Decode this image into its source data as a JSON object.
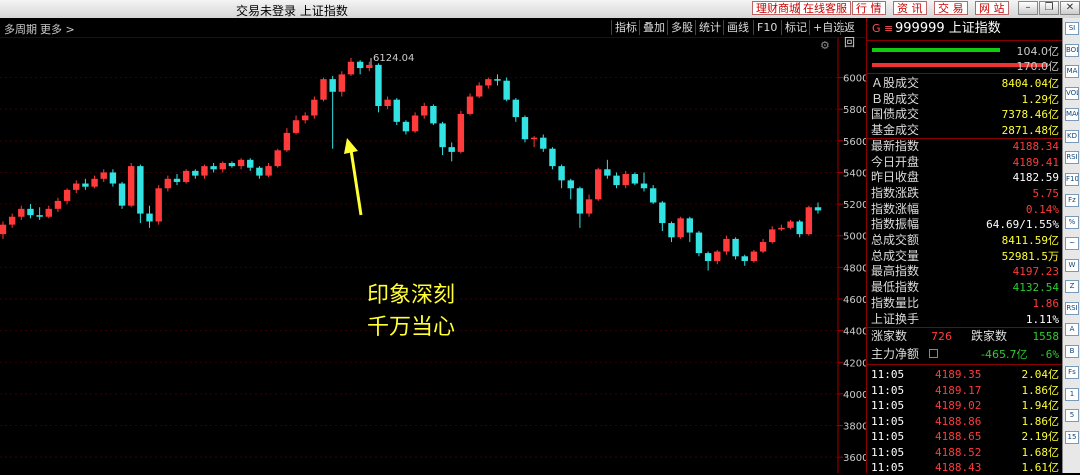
{
  "window": {
    "title": "交易未登录 上证指数",
    "top_buttons": [
      "理财商城",
      "在线客服",
      "行 情",
      "资 讯",
      "交 易",
      "网 站"
    ]
  },
  "toolbar": {
    "left_items": [
      "多周期",
      "更多 >"
    ],
    "right_items": [
      "指标",
      "叠加",
      "多股",
      "统计",
      "画线",
      "F10",
      "标记",
      "+自选",
      "返回"
    ]
  },
  "chart": {
    "y_ticks": [
      "6000",
      "5800",
      "5600",
      "5400",
      "5200",
      "5000",
      "4800",
      "4600",
      "4400",
      "4200",
      "4000",
      "3800",
      "3600"
    ],
    "peak_label": "6124.04",
    "annotation": [
      "印象深刻",
      "千万当心"
    ],
    "colors": {
      "up": "#ff3b3b",
      "down": "#33e3e3",
      "arrow": "#ffff33",
      "axis": "#aa0000"
    }
  },
  "chart_data": {
    "type": "candlestick",
    "ylim": [
      3500,
      6250
    ],
    "candles": [
      [
        5010,
        5070,
        4980,
        5090
      ],
      [
        5070,
        5120,
        5050,
        5140
      ],
      [
        5120,
        5170,
        5100,
        5190
      ],
      [
        5170,
        5130,
        5110,
        5200
      ],
      [
        5130,
        5120,
        5100,
        5180
      ],
      [
        5120,
        5170,
        5110,
        5190
      ],
      [
        5170,
        5220,
        5150,
        5240
      ],
      [
        5220,
        5290,
        5200,
        5300
      ],
      [
        5290,
        5330,
        5270,
        5350
      ],
      [
        5330,
        5310,
        5290,
        5360
      ],
      [
        5310,
        5360,
        5300,
        5380
      ],
      [
        5360,
        5400,
        5340,
        5420
      ],
      [
        5400,
        5330,
        5310,
        5420
      ],
      [
        5330,
        5190,
        5170,
        5340
      ],
      [
        5190,
        5440,
        5180,
        5460
      ],
      [
        5440,
        5140,
        5080,
        5450
      ],
      [
        5140,
        5090,
        5050,
        5190
      ],
      [
        5090,
        5300,
        5070,
        5320
      ],
      [
        5300,
        5360,
        5280,
        5380
      ],
      [
        5360,
        5340,
        5320,
        5390
      ],
      [
        5340,
        5410,
        5330,
        5420
      ],
      [
        5410,
        5380,
        5360,
        5420
      ],
      [
        5380,
        5440,
        5360,
        5450
      ],
      [
        5440,
        5420,
        5400,
        5460
      ],
      [
        5420,
        5460,
        5400,
        5470
      ],
      [
        5460,
        5440,
        5430,
        5470
      ],
      [
        5440,
        5480,
        5420,
        5490
      ],
      [
        5480,
        5430,
        5410,
        5490
      ],
      [
        5430,
        5380,
        5360,
        5440
      ],
      [
        5380,
        5440,
        5370,
        5460
      ],
      [
        5440,
        5540,
        5430,
        5550
      ],
      [
        5540,
        5650,
        5530,
        5680
      ],
      [
        5650,
        5730,
        5640,
        5760
      ],
      [
        5730,
        5760,
        5710,
        5780
      ],
      [
        5760,
        5860,
        5740,
        5880
      ],
      [
        5860,
        5990,
        5850,
        6000
      ],
      [
        5990,
        5910,
        5550,
        6010
      ],
      [
        5910,
        6020,
        5880,
        6040
      ],
      [
        6020,
        6100,
        6010,
        6124
      ],
      [
        6100,
        6060,
        6020,
        6110
      ],
      [
        6060,
        6080,
        6040,
        6100
      ],
      [
        6080,
        5820,
        5780,
        6090
      ],
      [
        5820,
        5860,
        5800,
        5880
      ],
      [
        5860,
        5720,
        5700,
        5870
      ],
      [
        5720,
        5660,
        5640,
        5730
      ],
      [
        5660,
        5760,
        5650,
        5780
      ],
      [
        5760,
        5820,
        5740,
        5840
      ],
      [
        5820,
        5710,
        5700,
        5830
      ],
      [
        5710,
        5560,
        5510,
        5720
      ],
      [
        5560,
        5530,
        5470,
        5590
      ],
      [
        5530,
        5770,
        5520,
        5790
      ],
      [
        5770,
        5880,
        5760,
        5900
      ],
      [
        5880,
        5950,
        5870,
        5970
      ],
      [
        5950,
        5990,
        5930,
        6000
      ],
      [
        5990,
        5980,
        5950,
        6020
      ],
      [
        5980,
        5860,
        5850,
        6000
      ],
      [
        5860,
        5750,
        5720,
        5870
      ],
      [
        5750,
        5610,
        5590,
        5760
      ],
      [
        5610,
        5620,
        5560,
        5630
      ],
      [
        5620,
        5550,
        5530,
        5640
      ],
      [
        5550,
        5440,
        5420,
        5560
      ],
      [
        5440,
        5350,
        5300,
        5450
      ],
      [
        5350,
        5300,
        5230,
        5360
      ],
      [
        5300,
        5140,
        5050,
        5310
      ],
      [
        5140,
        5230,
        5120,
        5260
      ],
      [
        5230,
        5420,
        5220,
        5430
      ],
      [
        5420,
        5380,
        5360,
        5480
      ],
      [
        5380,
        5320,
        5300,
        5400
      ],
      [
        5320,
        5390,
        5300,
        5410
      ],
      [
        5390,
        5330,
        5320,
        5400
      ],
      [
        5330,
        5300,
        5280,
        5400
      ],
      [
        5300,
        5210,
        5200,
        5320
      ],
      [
        5210,
        5080,
        5030,
        5220
      ],
      [
        5080,
        4990,
        4960,
        5090
      ],
      [
        4990,
        5110,
        4980,
        5120
      ],
      [
        5110,
        5020,
        4960,
        5120
      ],
      [
        5020,
        4890,
        4870,
        5030
      ],
      [
        4890,
        4840,
        4780,
        4900
      ],
      [
        4840,
        4900,
        4820,
        4910
      ],
      [
        4900,
        4980,
        4880,
        5000
      ],
      [
        4980,
        4870,
        4850,
        4990
      ],
      [
        4870,
        4840,
        4810,
        4880
      ],
      [
        4840,
        4900,
        4830,
        4910
      ],
      [
        4900,
        4960,
        4890,
        4980
      ],
      [
        4960,
        5040,
        4950,
        5060
      ],
      [
        5040,
        5050,
        5030,
        5070
      ],
      [
        5050,
        5090,
        5040,
        5100
      ],
      [
        5090,
        5010,
        4990,
        5100
      ],
      [
        5010,
        5180,
        5000,
        5190
      ],
      [
        5180,
        5160,
        5140,
        5210
      ]
    ]
  },
  "quote": {
    "code_line": "999999 上证指数",
    "code_prefix": "G ≡",
    "bar1_value": "104.0亿",
    "bar2_value": "170.0亿",
    "rows": [
      {
        "label": "Ａ股成交",
        "value": "8404.04亿",
        "cls": "yel"
      },
      {
        "label": "Ｂ股成交",
        "value": "1.29亿",
        "cls": "yel"
      },
      {
        "label": "国债成交",
        "value": "7378.46亿",
        "cls": "yel"
      },
      {
        "label": "基金成交",
        "value": "2871.48亿",
        "cls": "yel"
      },
      {
        "label": "最新指数",
        "value": "4188.34",
        "cls": "red"
      },
      {
        "label": "今日开盘",
        "value": "4189.41",
        "cls": "red"
      },
      {
        "label": "昨日收盘",
        "value": "4182.59",
        "cls": "wht"
      },
      {
        "label": "指数涨跌",
        "value": "5.75",
        "cls": "red"
      },
      {
        "label": "指数涨幅",
        "value": "0.14%",
        "cls": "red"
      },
      {
        "label": "指数振幅",
        "value": "64.69/1.55%",
        "cls": "wht"
      },
      {
        "label": "总成交额",
        "value": "8411.59亿",
        "cls": "yel"
      },
      {
        "label": "总成交量",
        "value": "52981.5万",
        "cls": "yel"
      },
      {
        "label": "最高指数",
        "value": "4197.23",
        "cls": "red"
      },
      {
        "label": "最低指数",
        "value": "4132.54",
        "cls": "grn"
      },
      {
        "label": "指数量比",
        "value": "1.86",
        "cls": "red"
      },
      {
        "label": "上证换手",
        "value": "1.11%",
        "cls": "wht"
      }
    ],
    "rise_label": "涨家数",
    "rise_value": "726",
    "fall_label": "跌家数",
    "fall_value": "1558",
    "net_label": "主力净额",
    "net_value": "-465.7亿",
    "net_pct": "-6%",
    "ticks": [
      {
        "time": "11:05",
        "price": "4189.35",
        "amount": "2.04亿"
      },
      {
        "time": "11:05",
        "price": "4189.17",
        "amount": "1.86亿"
      },
      {
        "time": "11:05",
        "price": "4189.02",
        "amount": "1.94亿"
      },
      {
        "time": "11:05",
        "price": "4188.86",
        "amount": "1.86亿"
      },
      {
        "time": "11:05",
        "price": "4188.65",
        "amount": "2.19亿"
      },
      {
        "time": "11:05",
        "price": "4188.52",
        "amount": "1.68亿"
      },
      {
        "time": "11:05",
        "price": "4188.43",
        "amount": "1.61亿"
      }
    ]
  },
  "strip_icons": [
    "SI",
    "BOLL",
    "MA",
    "VOL",
    "MACD",
    "KD",
    "RSI",
    "F10",
    "Fz",
    "%",
    "~",
    "W",
    "Z",
    "RSI",
    "A",
    "B",
    "Fs",
    "1",
    "5",
    "15"
  ]
}
